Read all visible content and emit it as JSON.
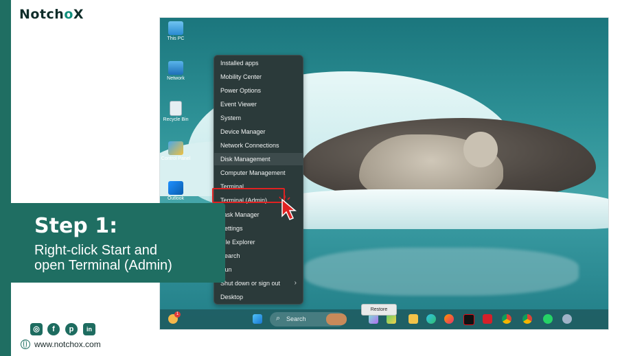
{
  "brand": {
    "logo_prefix": "Notch",
    "logo_accent": "o",
    "logo_suffix": "X"
  },
  "desktop_icons": [
    {
      "label": "This PC",
      "icon": "monitor-icon"
    },
    {
      "label": "Network",
      "icon": "network-icon"
    },
    {
      "label": "Recycle Bin",
      "icon": "recycle-bin-icon"
    },
    {
      "label": "Control Panel",
      "icon": "control-panel-icon"
    },
    {
      "label": "Outlook",
      "icon": "outlook-icon"
    }
  ],
  "context_menu": {
    "items": [
      {
        "label": "Installed apps"
      },
      {
        "label": "Mobility Center"
      },
      {
        "label": "Power Options"
      },
      {
        "label": "Event Viewer"
      },
      {
        "label": "System"
      },
      {
        "label": "Device Manager"
      },
      {
        "label": "Network Connections"
      },
      {
        "label": "Disk Management"
      },
      {
        "label": "Computer Management"
      },
      {
        "label": "Terminal"
      },
      {
        "label": "Terminal (Admin)"
      },
      {
        "label": "Task Manager"
      },
      {
        "label": "Settings"
      },
      {
        "label": "File Explorer"
      },
      {
        "label": "Search"
      },
      {
        "label": "Run"
      },
      {
        "label": "Shut down or sign out",
        "chevron": "›"
      },
      {
        "label": "Desktop"
      }
    ],
    "highlighted_item": "Terminal (Admin)"
  },
  "taskbar": {
    "search_placeholder": "Search",
    "tooltip": "Restore",
    "weather_badge": "1",
    "pinned_icons": [
      "start-icon",
      "widgets-icon",
      "copilot-icon",
      "file-explorer-icon",
      "edge-icon",
      "firefox-icon",
      "netflix-icon",
      "app-l-icon",
      "chrome-icon",
      "chrome-profile-icon",
      "whatsapp-icon",
      "settings-icon"
    ]
  },
  "step": {
    "title": "Step 1:",
    "description_line1": "Right-click Start and",
    "description_line2": "open Terminal (Admin)"
  },
  "footer": {
    "social": [
      "instagram-icon",
      "facebook-icon",
      "pinterest-icon",
      "linkedin-icon"
    ],
    "website": "www.notchox.com"
  },
  "colors": {
    "brand_green": "#1f6e62",
    "highlight_red": "#e02222"
  }
}
